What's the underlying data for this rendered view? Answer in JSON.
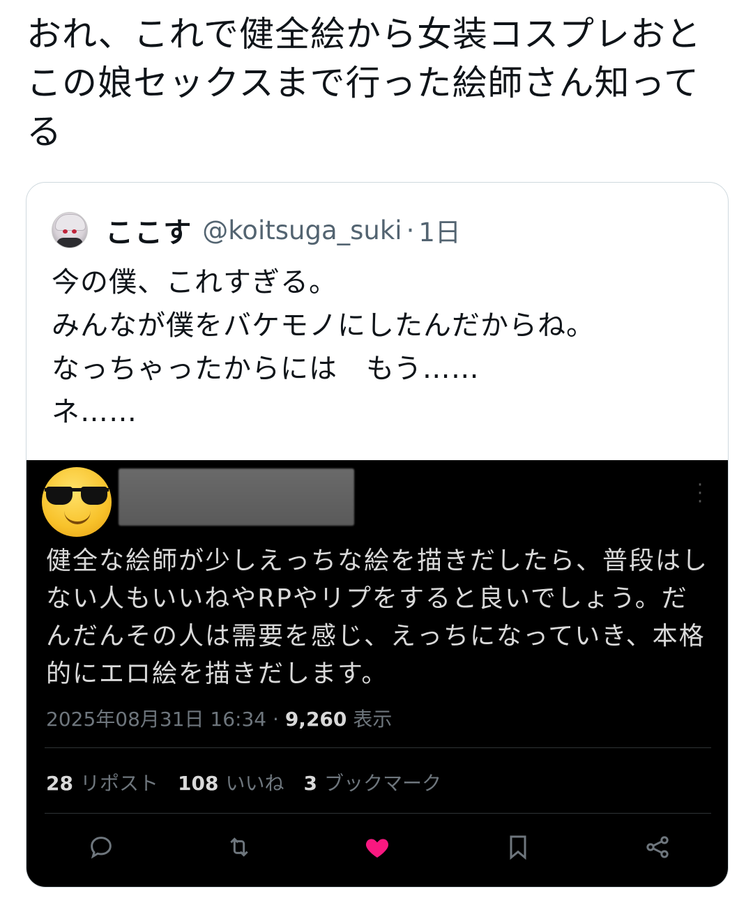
{
  "tweet": {
    "text": "おれ、これで健全絵から女装コスプレおとこの娘セックスまで行った絵師さん知ってる"
  },
  "quote": {
    "author_name": "ここす",
    "author_handle": "@koitsuga_suki",
    "separator": "·",
    "time": "1日",
    "text": "今の僕、これすぎる。\nみんなが僕をバケモノにしたんだからね。\nなっちゃったからには　もう……\nネ……"
  },
  "screenshot": {
    "text": "健全な絵師が少しえっちな絵を描きだしたら、普段はしない人もいいねやRPやリプをすると良いでしょう。だんだんその人は需要を感じ、えっちになっていき、本格的にエロ絵を描きだします。",
    "timestamp": "2025年08月31日 16:34",
    "separator": "·",
    "views_count": "9,260",
    "views_label": "表示",
    "reposts_count": "28",
    "reposts_label": "リポスト",
    "likes_count": "108",
    "likes_label": "いいね",
    "bookmarks_count": "3",
    "bookmarks_label": "ブックマーク",
    "like_color": "#f91880",
    "icons": [
      "reply-icon",
      "retweet-icon",
      "like-icon",
      "bookmark-icon",
      "share-icon"
    ]
  }
}
